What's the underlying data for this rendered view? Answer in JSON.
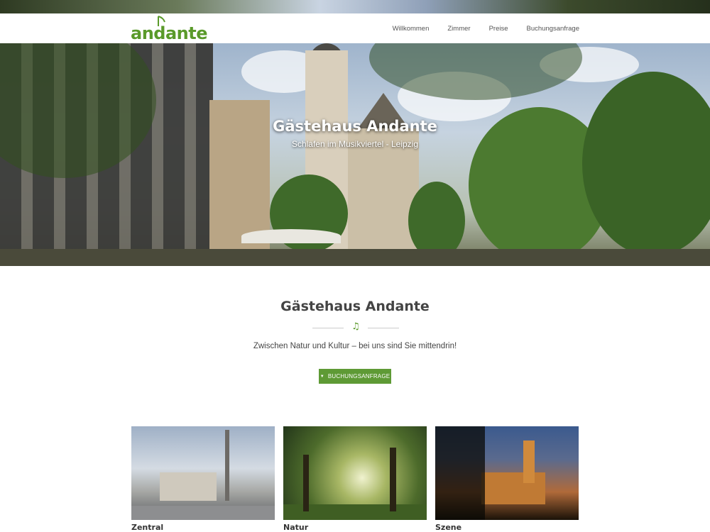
{
  "header": {
    "logo_text": "andante",
    "nav": [
      "Willkommen",
      "Zimmer",
      "Preise",
      "Buchungsanfrage"
    ]
  },
  "hero": {
    "title": "Gästehaus Andante",
    "subtitle": "Schlafen im Musikviertel - Leipzig"
  },
  "intro": {
    "title": "Gästehaus Andante",
    "divider_icon": "♫",
    "tagline": "Zwischen Natur und Kultur – bei uns sind Sie mittendrin!",
    "cta_label": "BUCHUNGSANFRAGE",
    "cta_icon": "▼"
  },
  "cards": [
    {
      "label": "Zentral"
    },
    {
      "label": "Natur"
    },
    {
      "label": "Szene"
    }
  ],
  "colors": {
    "brand_green": "#5e9a35"
  }
}
